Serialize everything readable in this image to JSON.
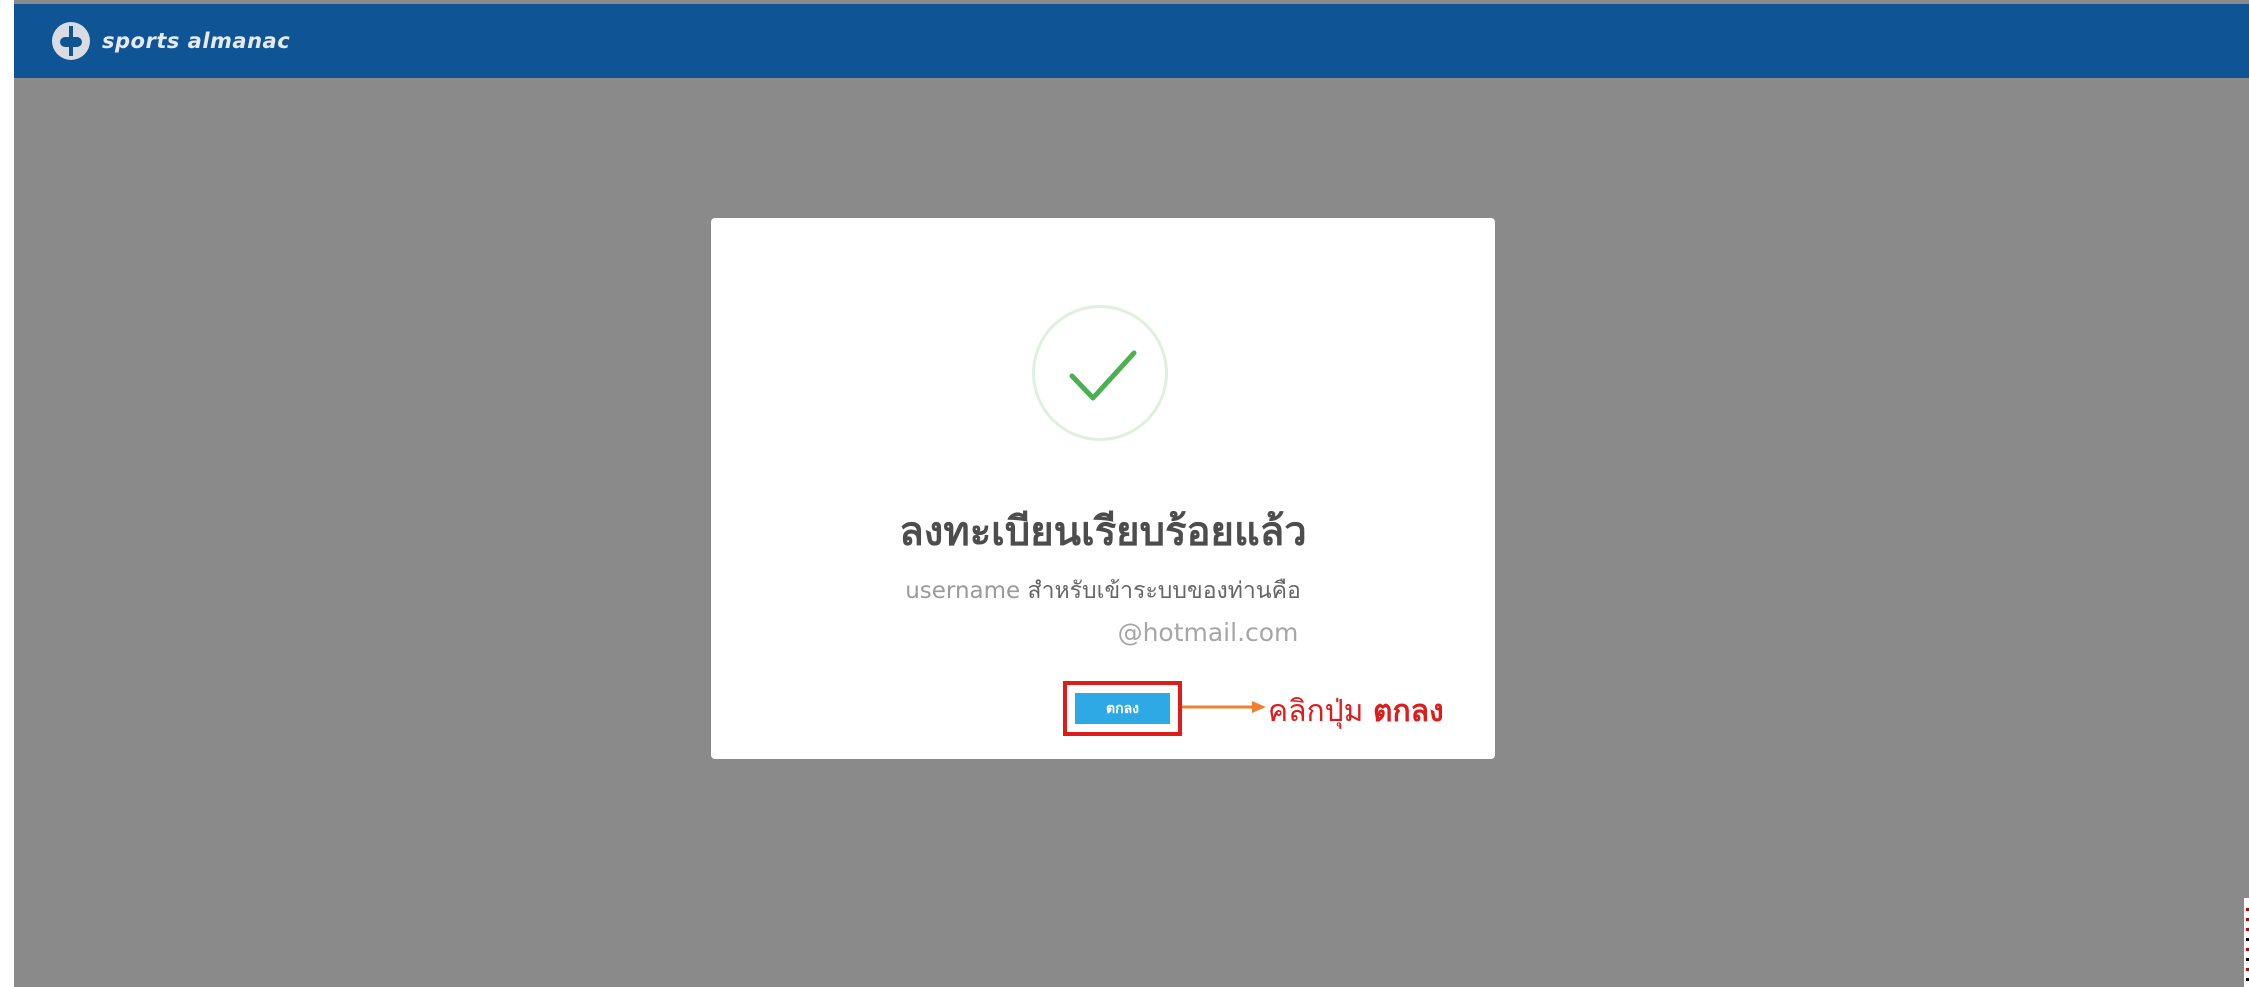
{
  "header": {
    "logo_text": "sports almanac",
    "background_color": "#0f5596"
  },
  "modal": {
    "icon": "checkmark-success-icon",
    "title": "ลงทะเบียนเรียบร้อยแล้ว",
    "username_label": "username",
    "message": "สำหรับเข้าระบบของท่านคือ",
    "email": "@hotmail.com",
    "ok_button_label": "ตกลง"
  },
  "annotation": {
    "prefix": "คลิกปุ่ม",
    "emphasis": "ตกลง",
    "color": "#e01b1b",
    "arrow_color": "#f08030"
  },
  "colors": {
    "overlay": "#8a8a8a",
    "ok_button": "#2fa9e6",
    "check": "#4caf50"
  }
}
